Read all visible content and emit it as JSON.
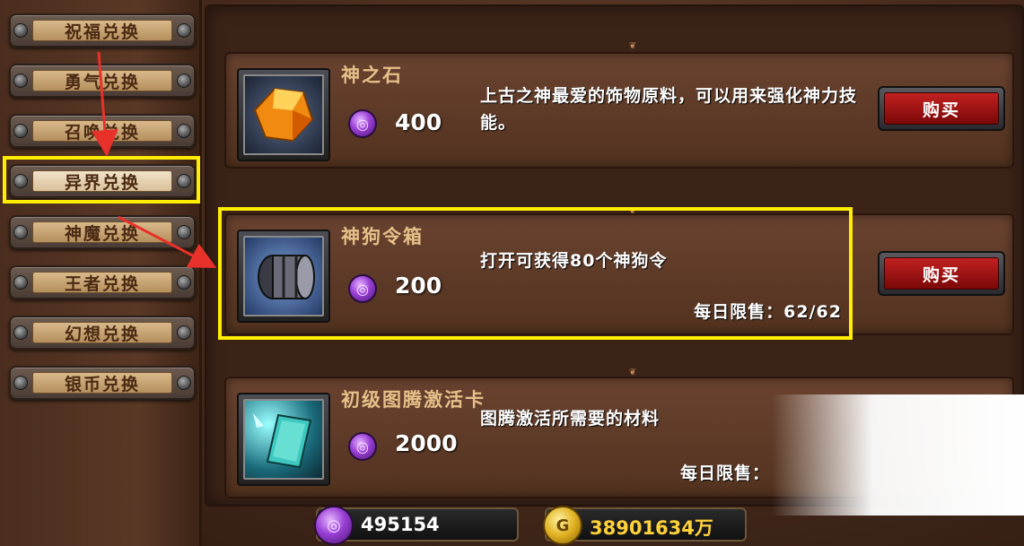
{
  "tabs": [
    {
      "label": "祝福兑换",
      "active": false
    },
    {
      "label": "勇气兑换",
      "active": false
    },
    {
      "label": "召唤兑换",
      "active": false
    },
    {
      "label": "异界兑换",
      "active": true
    },
    {
      "label": "神魔兑换",
      "active": false
    },
    {
      "label": "王者兑换",
      "active": false
    },
    {
      "label": "幻想兑换",
      "active": false
    },
    {
      "label": "银币兑换",
      "active": false
    }
  ],
  "items": [
    {
      "name": "神之石",
      "cost": "400",
      "description": "上古之神最爱的饰物原料，可以用来强化神力技能。",
      "limit": "",
      "buy_label": "购买",
      "icon": "orange-gem-icon"
    },
    {
      "name": "神狗令箱",
      "cost": "200",
      "description": "打开可获得80个神狗令",
      "limit": "每日限售：62/62",
      "buy_label": "购买",
      "icon": "barrel-icon"
    },
    {
      "name": "初级图腾激活卡",
      "cost": "2000",
      "description": "图腾激活所需要的材料",
      "limit": "每日限售：",
      "buy_label": "",
      "icon": "teal-card-icon"
    }
  ],
  "currency": {
    "gems": "495154",
    "gold": "38901634万"
  },
  "colors": {
    "highlight": "#ffee00",
    "arrow": "#e8312a",
    "buy_button": "#c22020",
    "gold_text": "#ffd23a"
  }
}
